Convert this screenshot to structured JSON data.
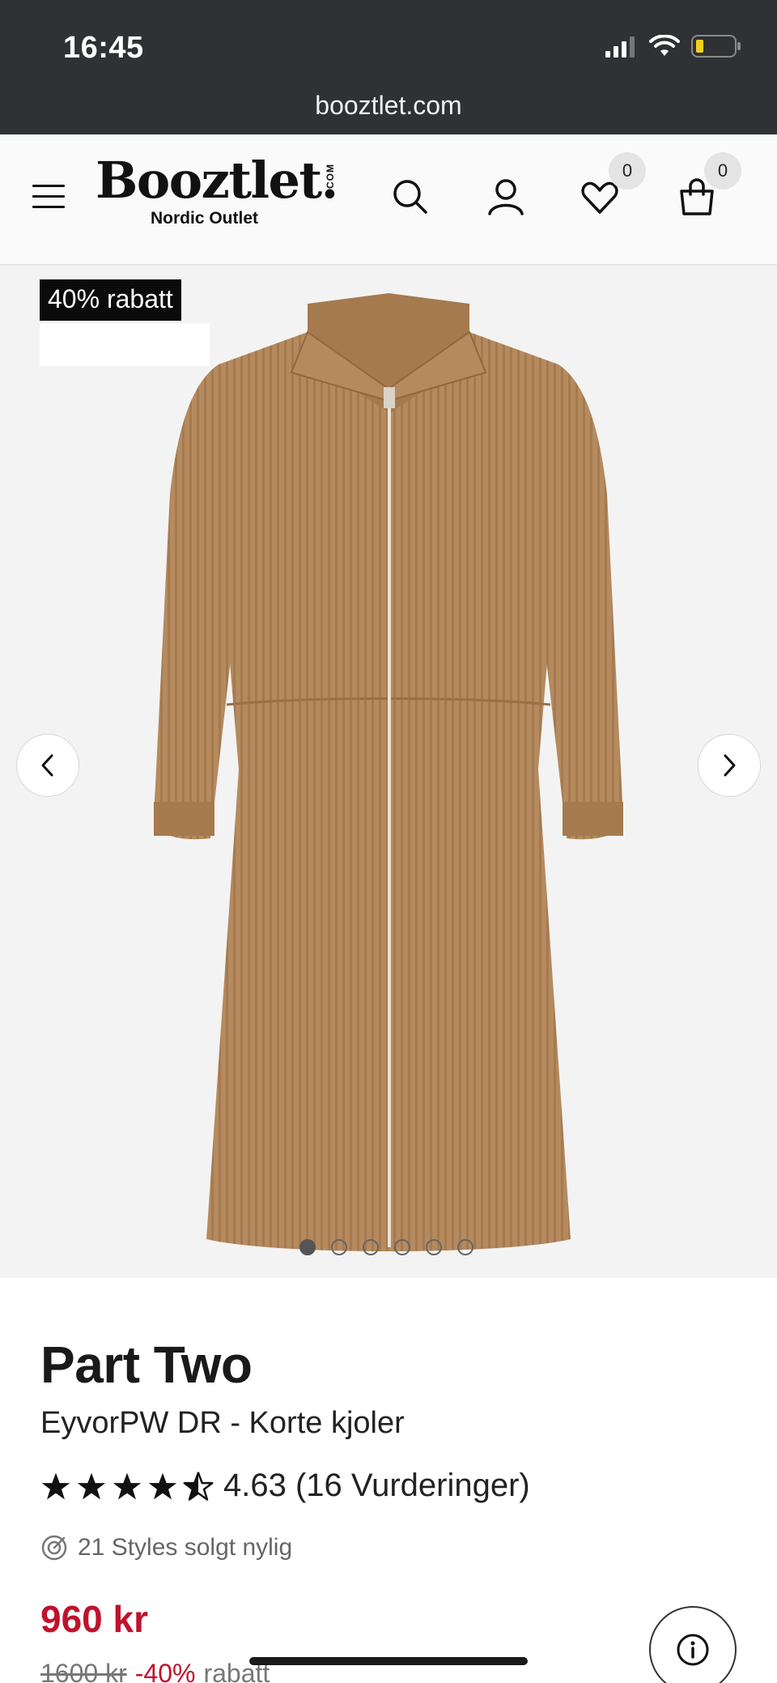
{
  "status_bar": {
    "time": "16:45",
    "url": "booztlet.com"
  },
  "header": {
    "logo_main": "Booztlet.",
    "logo_com": "COM",
    "logo_sub": "Nordic Outlet",
    "wishlist_count": "0",
    "cart_count": "0",
    "icons": [
      "menu-icon",
      "search-icon",
      "account-icon",
      "heart-icon",
      "bag-icon"
    ]
  },
  "gallery": {
    "promo_label": "40% rabatt",
    "image_count": 6,
    "active_index": 0,
    "dress_color": "#b58a5e"
  },
  "product": {
    "brand": "Part Two",
    "name": "EyvorPW DR - Korte kjoler",
    "rating_value": 4.63,
    "rating_text": "4.63 (16 Vurderinger)",
    "sold_text": "21 Styles solgt nylig",
    "price": "960 kr",
    "old_price": "1600 kr",
    "discount": "-40%",
    "discount_suffix": "rabatt"
  },
  "colors": {
    "price_red": "#c0122c",
    "status_bar_bg": "#2f3134"
  }
}
